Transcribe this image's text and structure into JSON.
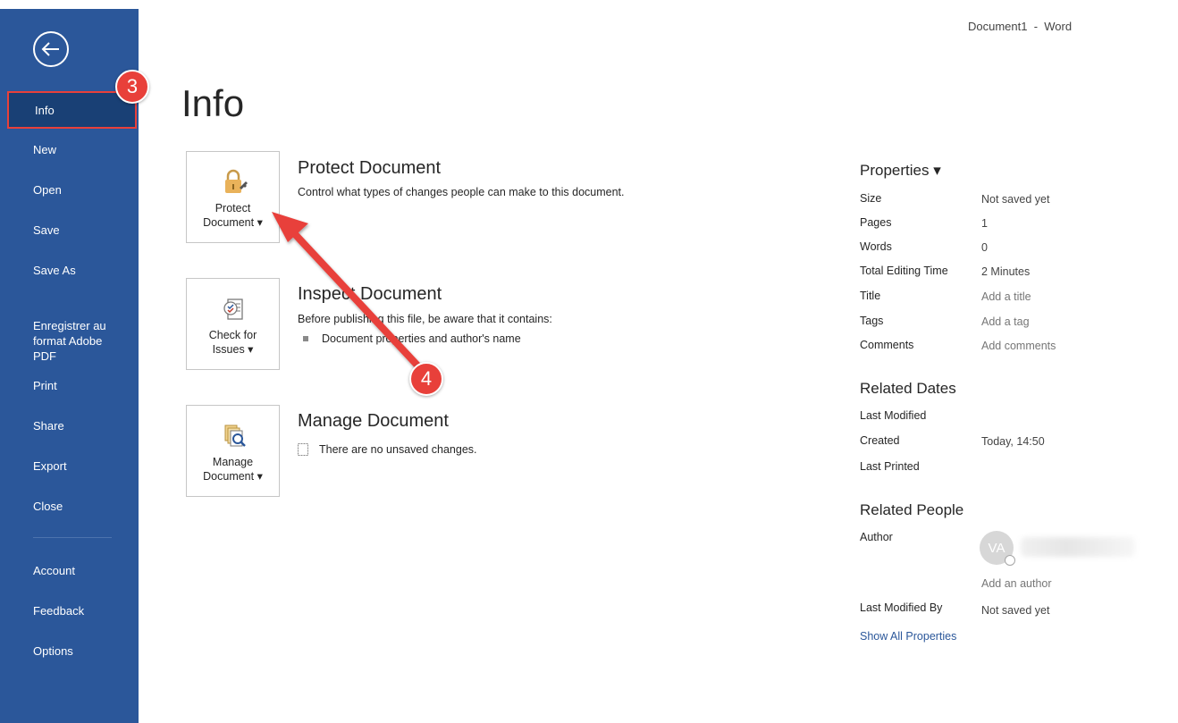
{
  "window": {
    "title": "Document1  -  Word"
  },
  "sidebar": {
    "items": [
      {
        "label": "Info"
      },
      {
        "label": "New"
      },
      {
        "label": "Open"
      },
      {
        "label": "Save"
      },
      {
        "label": "Save As"
      },
      {
        "label": "Enregistrer au\nformat Adobe\nPDF"
      },
      {
        "label": "Print"
      },
      {
        "label": "Share"
      },
      {
        "label": "Export"
      },
      {
        "label": "Close"
      },
      {
        "label": "Account"
      },
      {
        "label": "Feedback"
      },
      {
        "label": "Options"
      }
    ],
    "accent": "#2b579a",
    "selected_index": 0
  },
  "main": {
    "title": "Info",
    "protect": {
      "tile_label_1": "Protect",
      "tile_label_2": "Document ▾",
      "title": "Protect Document",
      "description": "Control what types of changes people can make to this document."
    },
    "inspect": {
      "tile_label_1": "Check for",
      "tile_label_2": "Issues ▾",
      "title": "Inspect Document",
      "description": "Before publishing this file, be aware that it contains:",
      "bullets": [
        "Document properties and author's name"
      ]
    },
    "manage": {
      "tile_label_1": "Manage",
      "tile_label_2": "Document ▾",
      "title": "Manage Document",
      "description": "There are no unsaved changes."
    }
  },
  "properties": {
    "heading": "Properties ▾",
    "rows": [
      {
        "label": "Size",
        "value": "Not saved yet"
      },
      {
        "label": "Pages",
        "value": "1"
      },
      {
        "label": "Words",
        "value": "0"
      },
      {
        "label": "Total Editing Time",
        "value": "2 Minutes"
      },
      {
        "label": "Title",
        "value": "Add a title"
      },
      {
        "label": "Tags",
        "value": "Add a tag"
      },
      {
        "label": "Comments",
        "value": "Add comments"
      }
    ],
    "related_dates": {
      "heading": "Related Dates",
      "rows": [
        {
          "label": "Last Modified",
          "value": ""
        },
        {
          "label": "Created",
          "value": "Today, 14:50"
        },
        {
          "label": "Last Printed",
          "value": ""
        }
      ]
    },
    "related_people": {
      "heading": "Related People",
      "author_label": "Author",
      "author_initials": "VA",
      "add_author": "Add an author",
      "last_modified_by_label": "Last Modified By",
      "last_modified_by_value": "Not saved yet"
    },
    "show_all": "Show All Properties"
  },
  "callouts": {
    "step3": "3",
    "step4": "4",
    "color": "#e8403a"
  }
}
